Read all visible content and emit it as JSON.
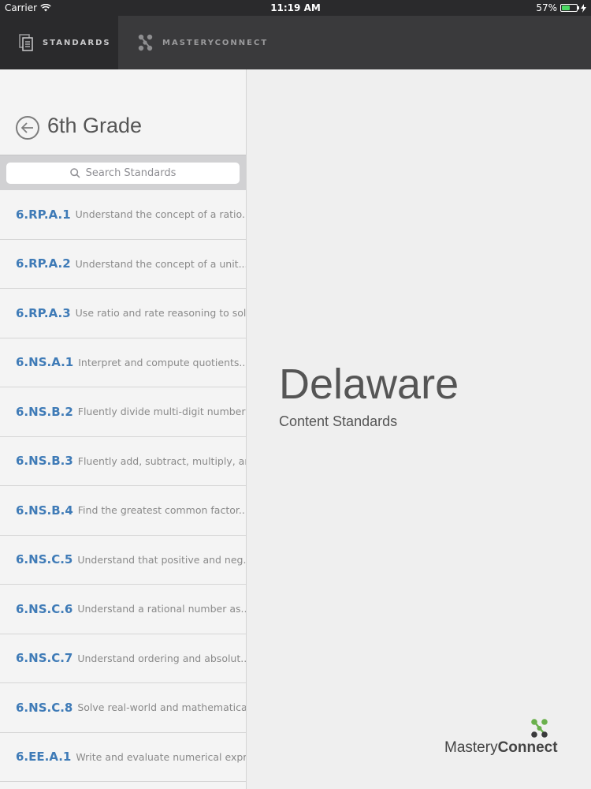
{
  "status_bar": {
    "carrier": "Carrier",
    "time": "11:19 AM",
    "battery": "57%",
    "battery_level": 0.57
  },
  "tabs": [
    {
      "label": "STANDARDS",
      "icon": "document-icon",
      "active": true
    },
    {
      "label": "MASTERYCONNECT",
      "icon": "masteryconnect-logo-icon",
      "active": false
    }
  ],
  "sidebar": {
    "title": "6th Grade",
    "search_placeholder": "Search Standards",
    "standards": [
      {
        "code": "6.RP.A.1",
        "desc": "Understand the concept of a ratio..."
      },
      {
        "code": "6.RP.A.2",
        "desc": "Understand the concept of a unit..."
      },
      {
        "code": "6.RP.A.3",
        "desc": "Use ratio and rate reasoning to sol..."
      },
      {
        "code": "6.NS.A.1",
        "desc": "Interpret and compute quotients..."
      },
      {
        "code": "6.NS.B.2",
        "desc": "Fluently divide multi-digit numbers..."
      },
      {
        "code": "6.NS.B.3",
        "desc": "Fluently add, subtract, multiply, an..."
      },
      {
        "code": "6.NS.B.4",
        "desc": "Find the greatest common factor..."
      },
      {
        "code": "6.NS.C.5",
        "desc": "Understand that positive and neg..."
      },
      {
        "code": "6.NS.C.6",
        "desc": "Understand a rational number as..."
      },
      {
        "code": "6.NS.C.7",
        "desc": "Understand ordering and absolut..."
      },
      {
        "code": "6.NS.C.8",
        "desc": "Solve real-world and mathematical..."
      },
      {
        "code": "6.EE.A.1",
        "desc": "Write and evaluate numerical expr..."
      }
    ]
  },
  "main": {
    "state": "Delaware",
    "subtitle": "Content Standards",
    "brand_part1": "Mastery",
    "brand_part2": "Connect"
  },
  "colors": {
    "accent_blue": "#3f7bb7",
    "brand_green": "#6ab04c",
    "tabbar_bg": "#3a3a3c"
  }
}
